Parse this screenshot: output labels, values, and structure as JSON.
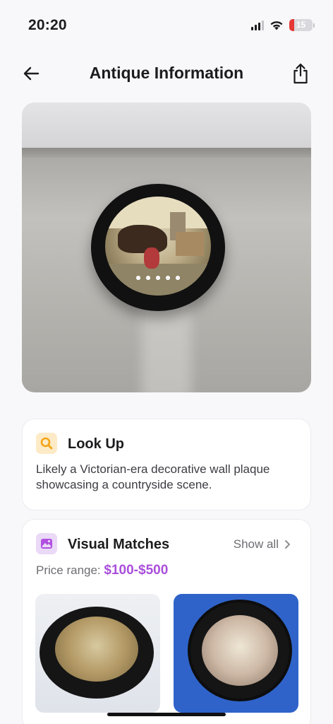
{
  "status_bar": {
    "time": "20:20",
    "battery_level": "15",
    "icons": [
      "signal-icon",
      "wifi-icon",
      "battery-icon"
    ]
  },
  "nav": {
    "title": "Antique Information",
    "back_icon": "arrow-left-icon",
    "share_icon": "share-icon"
  },
  "hero": {
    "image_icon": "antique-photo"
  },
  "lookup": {
    "icon": "search-icon",
    "title": "Look Up",
    "description": "Likely a Victorian-era decorative wall plaque showcasing a countryside scene."
  },
  "visual_matches": {
    "icon": "gallery-icon",
    "title": "Visual Matches",
    "show_all": "Show all",
    "price_label": "Price range:",
    "price_value": "$100-$500"
  },
  "colors": {
    "accent_purple": "#a94fdb",
    "lookup_icon_bg": "#fdebc8",
    "lookup_icon_fg": "#f2a516",
    "matches_icon_bg": "#ead9f7",
    "matches_icon_fg": "#b14fe0",
    "battery_red": "#e53935"
  }
}
